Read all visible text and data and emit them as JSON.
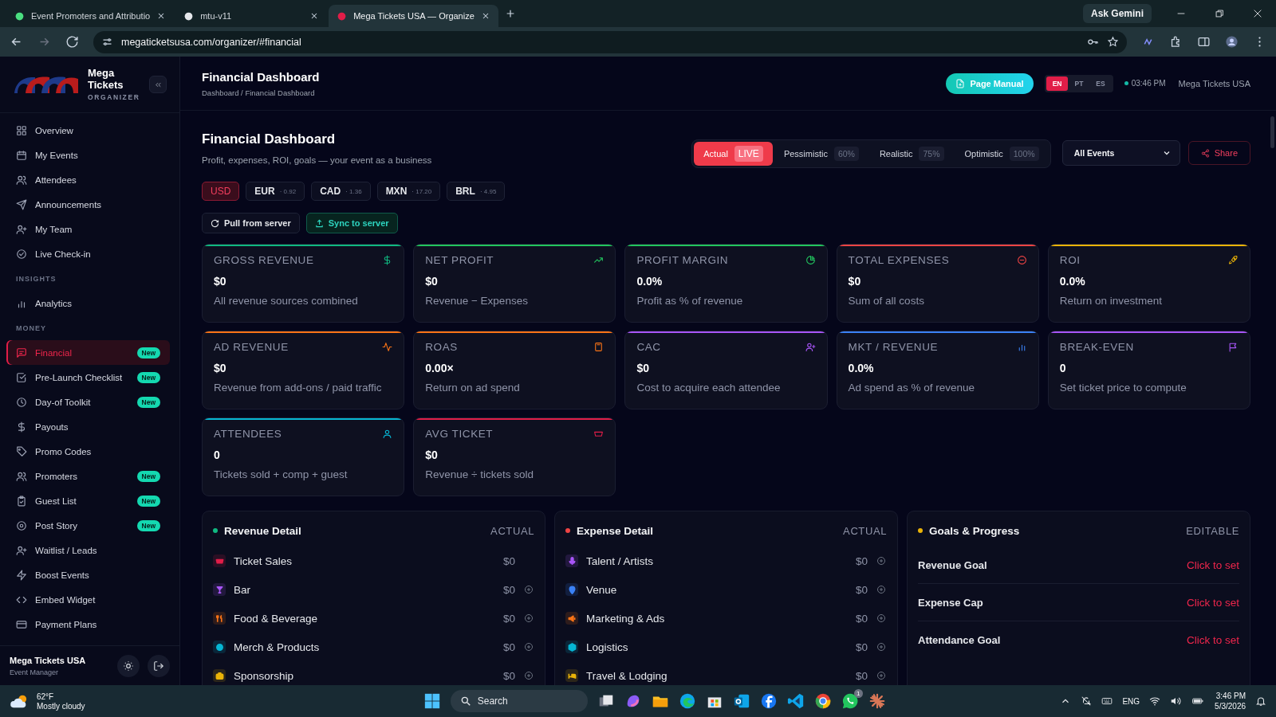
{
  "browser": {
    "tabs": [
      {
        "title": "Event Promoters and Attributio",
        "selected": false
      },
      {
        "title": "mtu-v11",
        "selected": false
      },
      {
        "title": "Mega Tickets USA — Organize",
        "selected": true
      }
    ],
    "ask": "Ask Gemini",
    "url": "megaticketsusa.com/organizer/#financial"
  },
  "sidebar": {
    "brand": "Mega Tickets",
    "brand_sub": "ORGANIZER",
    "sections": [
      {
        "items": [
          {
            "label": "Overview",
            "selected": false
          },
          {
            "label": "My Events",
            "selected": false
          },
          {
            "label": "Attendees",
            "selected": false
          },
          {
            "label": "Announcements",
            "selected": false
          },
          {
            "label": "My Team",
            "selected": false
          },
          {
            "label": "Live Check-in",
            "selected": false
          }
        ]
      },
      {
        "heading": "INSIGHTS",
        "items": [
          {
            "label": "Analytics",
            "selected": false
          }
        ]
      },
      {
        "heading": "MONEY",
        "items": [
          {
            "label": "Financial",
            "selected": true,
            "badge": "New"
          },
          {
            "label": "Pre-Launch Checklist",
            "selected": false,
            "badge": "New"
          },
          {
            "label": "Day-of Toolkit",
            "selected": false,
            "badge": "New"
          },
          {
            "label": "Payouts",
            "selected": false
          },
          {
            "label": "Promo Codes",
            "selected": false
          },
          {
            "label": "Promoters",
            "selected": false,
            "badge": "New"
          },
          {
            "label": "Guest List",
            "selected": false,
            "badge": "New"
          },
          {
            "label": "Post Story",
            "selected": false,
            "badge": "New"
          },
          {
            "label": "Waitlist / Leads",
            "selected": false
          },
          {
            "label": "Boost Events",
            "selected": false
          },
          {
            "label": "Embed Widget",
            "selected": false
          },
          {
            "label": "Payment Plans",
            "selected": false
          }
        ]
      }
    ],
    "user": {
      "name": "Mega Tickets USA",
      "role": "Event Manager"
    }
  },
  "header": {
    "title": "Financial Dashboard",
    "breadcrumb": "Dashboard / Financial Dashboard",
    "manual": "Page Manual",
    "languages": [
      {
        "label": "EN",
        "selected": true
      },
      {
        "label": "PT",
        "selected": false
      },
      {
        "label": "ES",
        "selected": false
      }
    ],
    "time": "03:46 PM",
    "org": "Mega Tickets USA"
  },
  "dashboard": {
    "title": "Financial Dashboard",
    "subtitle": "Profit, expenses, ROI, goals — your event as a business",
    "scenarios": [
      {
        "label": "Actual",
        "badge": "LIVE",
        "selected": true
      },
      {
        "label": "Pessimistic",
        "badge": "60%",
        "selected": false
      },
      {
        "label": "Realistic",
        "badge": "75%",
        "selected": false
      },
      {
        "label": "Optimistic",
        "badge": "100%",
        "selected": false
      }
    ],
    "event_select": "All Events",
    "share": "Share",
    "currencies": [
      {
        "code": "USD",
        "selected": true
      },
      {
        "code": "EUR",
        "rate": "· 0.92",
        "selected": false
      },
      {
        "code": "CAD",
        "rate": "· 1.36",
        "selected": false
      },
      {
        "code": "MXN",
        "rate": "· 17.20",
        "selected": false
      },
      {
        "code": "BRL",
        "rate": "· 4.95",
        "selected": false
      }
    ],
    "actions": [
      {
        "label": "Pull from server",
        "kind": "pull"
      },
      {
        "label": "Sync to server",
        "kind": "sync"
      }
    ],
    "cards": [
      {
        "label": "GROSS REVENUE",
        "value": "$0",
        "note": "All revenue sources combined",
        "color": "#10b981"
      },
      {
        "label": "NET PROFIT",
        "value": "$0",
        "note": "Revenue − Expenses",
        "color": "#22c55e"
      },
      {
        "label": "PROFIT MARGIN",
        "value": "0.0%",
        "note": "Profit as % of revenue",
        "color": "#22c55e"
      },
      {
        "label": "TOTAL EXPENSES",
        "value": "$0",
        "note": "Sum of all costs",
        "color": "#ef4444"
      },
      {
        "label": "ROI",
        "value": "0.0%",
        "note": "Return on investment",
        "color": "#eab308"
      },
      {
        "label": "AD REVENUE",
        "value": "$0",
        "note": "Revenue from add-ons / paid traffic",
        "color": "#f97316"
      },
      {
        "label": "ROAS",
        "value": "0.00×",
        "note": "Return on ad spend",
        "color": "#f97316"
      },
      {
        "label": "CAC",
        "value": "$0",
        "note": "Cost to acquire each attendee",
        "color": "#a855f7"
      },
      {
        "label": "MKT / REVENUE",
        "value": "0.0%",
        "note": "Ad spend as % of revenue",
        "color": "#3b82f6"
      },
      {
        "label": "BREAK-EVEN",
        "value": "0",
        "note": "Set ticket price to compute",
        "color": "#a855f7"
      },
      {
        "label": "ATTENDEES",
        "value": "0",
        "note": "Tickets sold + comp + guest",
        "color": "#06b6d4"
      },
      {
        "label": "AVG TICKET",
        "value": "$0",
        "note": "Revenue ÷ tickets sold",
        "color": "#e11d48"
      }
    ],
    "panels": [
      {
        "title": "Revenue Detail",
        "tag": "ACTUAL",
        "color": "#10b981",
        "rows": [
          {
            "label": "Ticket Sales",
            "value": "$0",
            "addable": false,
            "color": "#e11d48"
          },
          {
            "label": "Bar",
            "value": "$0",
            "addable": true,
            "color": "#a855f7"
          },
          {
            "label": "Food & Beverage",
            "value": "$0",
            "addable": true,
            "color": "#f97316"
          },
          {
            "label": "Merch & Products",
            "value": "$0",
            "addable": true,
            "color": "#06b6d4"
          },
          {
            "label": "Sponsorship",
            "value": "$0",
            "addable": true,
            "color": "#eab308"
          }
        ]
      },
      {
        "title": "Expense Detail",
        "tag": "ACTUAL",
        "color": "#ef4444",
        "rows": [
          {
            "label": "Talent / Artists",
            "value": "$0",
            "addable": true,
            "color": "#a855f7"
          },
          {
            "label": "Venue",
            "value": "$0",
            "addable": true,
            "color": "#3b82f6"
          },
          {
            "label": "Marketing & Ads",
            "value": "$0",
            "addable": true,
            "color": "#f97316"
          },
          {
            "label": "Logistics",
            "value": "$0",
            "addable": true,
            "color": "#06b6d4"
          },
          {
            "label": "Travel & Lodging",
            "value": "$0",
            "addable": true,
            "color": "#eab308"
          }
        ]
      }
    ],
    "goals": {
      "title": "Goals & Progress",
      "tag": "EDITABLE",
      "color": "#eab308",
      "rows": [
        {
          "label": "Revenue Goal",
          "action": "Click to set"
        },
        {
          "label": "Expense Cap",
          "action": "Click to set"
        },
        {
          "label": "Attendance Goal",
          "action": "Click to set"
        }
      ]
    }
  },
  "taskbar": {
    "temp": "62°F",
    "weather": "Mostly cloudy",
    "search": "Search",
    "chat_badge": "1",
    "lang": "ENG",
    "time": "3:46 PM",
    "date": "5/3/2026"
  }
}
